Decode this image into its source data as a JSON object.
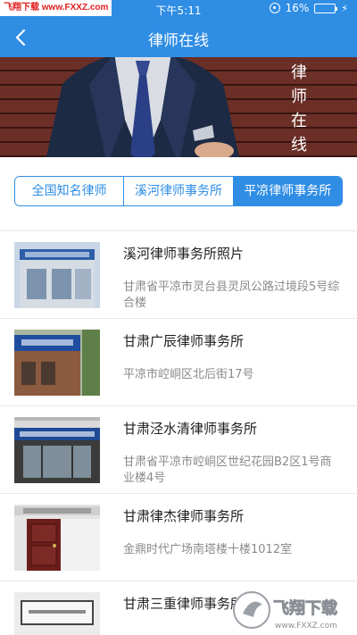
{
  "status_bar": {
    "watermark": "飞翔下载 www.FXXZ.com",
    "time": "下午5:11",
    "battery": "16%",
    "battery_level": 0.16
  },
  "nav": {
    "title": "律师在线"
  },
  "banner": {
    "text": [
      "律",
      "师",
      "在",
      "线"
    ]
  },
  "segments": [
    {
      "label": "全国知名律师",
      "active": false
    },
    {
      "label": "溪河律师事务所",
      "active": false
    },
    {
      "label": "平凉律师事务所",
      "active": true
    }
  ],
  "list": [
    {
      "name": "溪河律师事务所照片",
      "address": "甘肃省平凉市灵台县灵凤公路过境段5号综合楼"
    },
    {
      "name": "甘肃广辰律师事务所",
      "address": "平凉市崆峒区北后街17号"
    },
    {
      "name": "甘肃泾水清律师事务所",
      "address": "甘肃省平凉市崆峒区世纪花园B2区1号商业楼4号"
    },
    {
      "name": "甘肃律杰律师事务所",
      "address": "金鼎时代广场南塔楼十楼1012室"
    },
    {
      "name": "甘肃三重律师事务所",
      "address": ""
    }
  ],
  "site_logo": {
    "text": "飞翔下载",
    "url": "www.FXXZ.com"
  }
}
